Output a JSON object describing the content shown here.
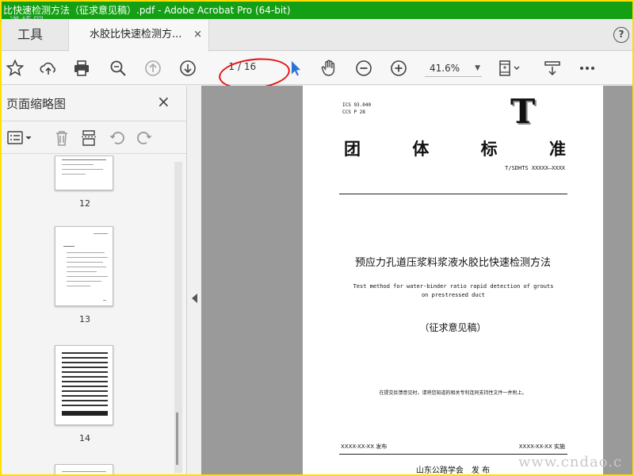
{
  "window": {
    "title": "比快速检测方法（征求意见稿）.pdf - Adobe Acrobat Pro (64-bit)"
  },
  "watermarks": {
    "top": "道桥网",
    "bottom": "www.cndao.c"
  },
  "tabs": {
    "tools_label": "工具",
    "doc_label": "水胶比快速检测方...",
    "close_glyph": "×",
    "help_glyph": "?"
  },
  "toolbar": {
    "page_current": "1",
    "page_total": "/ 16",
    "zoom": "41.6%",
    "icons": [
      "star-icon",
      "upload-icon",
      "print-icon",
      "zoom-search-icon",
      "page-up-icon",
      "page-down-icon",
      "select-pointer-icon",
      "hand-icon",
      "zoom-out-icon",
      "zoom-in-icon",
      "fit-page-icon",
      "scroll-mode-icon",
      "more-icon"
    ],
    "annotation_color": "#e01515"
  },
  "panel": {
    "title": "页面缩略图",
    "close_glyph": "×",
    "thumbnails": [
      {
        "label": "12"
      },
      {
        "label": "13"
      },
      {
        "label": "14"
      }
    ]
  },
  "document": {
    "ics": "ICS 93.040",
    "ccs": "CCS P 28",
    "big_letter": "T",
    "standard_title": [
      "团",
      "体",
      "标",
      "准"
    ],
    "standard_code": "T/SDHTS XXXXX—XXXX",
    "cn_title": "预应力孔道压浆料浆液水胶比快速检测方法",
    "en_title_line1": "Test method for water-binder ratio rapid detection of grouts",
    "en_title_line2": "on prestressed duct",
    "draft": "（征求意见稿）",
    "notice": "在提交反馈意见时，请将您知道的相关专利连同支持性文件一并附上。",
    "release_date": "XXXX-XX-XX 发布",
    "implement_date": "XXXX-XX-XX 实施",
    "issuer": "山东公路学会　发 布"
  },
  "colors": {
    "titlebar": "#14a014",
    "frame": "#ffde00",
    "accent_pointer": "#2a74d6"
  }
}
